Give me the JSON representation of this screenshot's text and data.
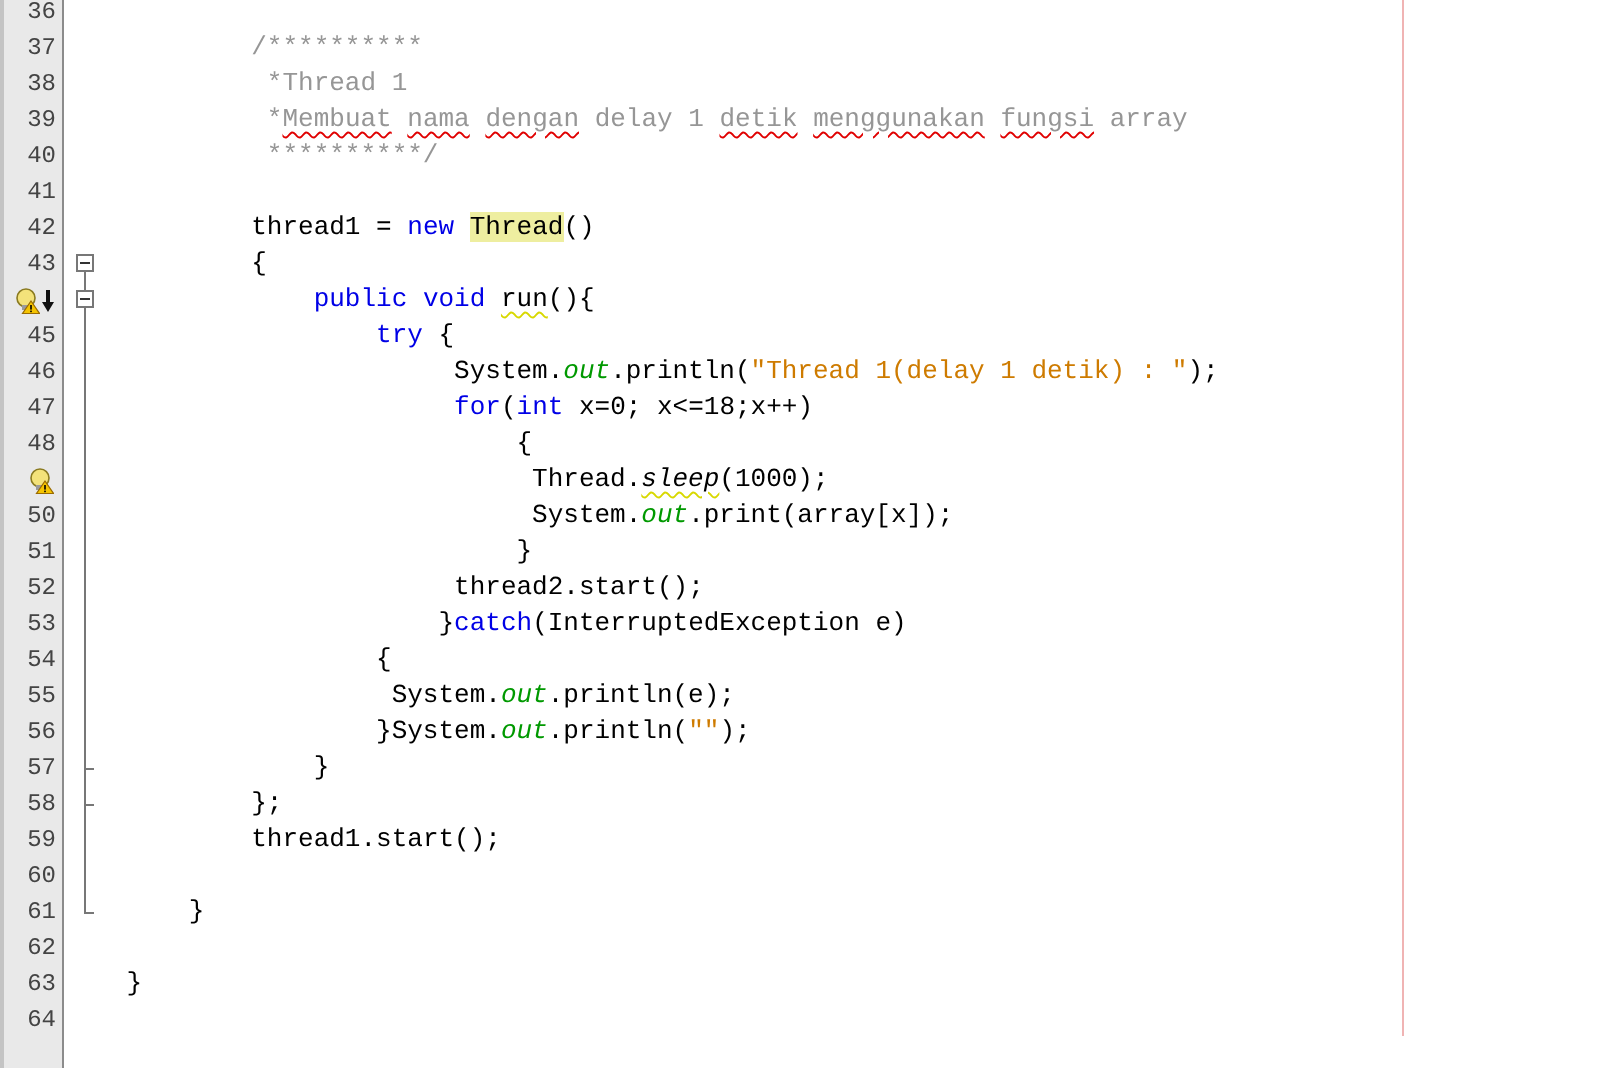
{
  "lines": [
    {
      "number": "36"
    },
    {
      "number": "37",
      "tokens": [
        {
          "kind": "comment",
          "text": "            /**********"
        }
      ]
    },
    {
      "number": "38",
      "tokens": [
        {
          "kind": "comment",
          "text": "             *Thread 1"
        }
      ]
    },
    {
      "number": "39",
      "tokens": [
        {
          "kind": "comment",
          "text": "             *"
        },
        {
          "kind": "misspelled",
          "text": "Membuat"
        },
        {
          "kind": "misspelled",
          "text": " nama"
        },
        {
          "kind": "misspelled",
          "text": " dengan"
        },
        {
          "kind": "comment",
          "text": " delay 1"
        },
        {
          "kind": "misspelled",
          "text": " detik"
        },
        {
          "kind": "misspelled",
          "text": " menggunakan"
        },
        {
          "kind": "misspelled",
          "text": " fungsi"
        },
        {
          "kind": "comment",
          "text": " array"
        }
      ]
    },
    {
      "number": "40",
      "tokens": [
        {
          "kind": "comment",
          "text": "             **********/"
        }
      ]
    },
    {
      "number": "41"
    },
    {
      "number": "42",
      "tokens": [
        {
          "kind": "plain",
          "text": "            thread1 ="
        },
        {
          "kind": "keyword",
          "text": " new"
        },
        {
          "kind": "occurrence",
          "text": " Thread"
        },
        {
          "kind": "plain",
          "text": "()"
        }
      ]
    },
    {
      "number": "43",
      "fold": {
        "kind": "start",
        "expanded": true
      },
      "tokens": [
        {
          "kind": "plain",
          "text": "            {"
        }
      ]
    },
    {
      "markers": [
        {
          "kind": "hint"
        },
        {
          "kind": "implements"
        }
      ],
      "fold": {
        "kind": "start",
        "expanded": true
      },
      "tokens": [
        {
          "kind": "keyword",
          "text": "                public"
        },
        {
          "kind": "keyword",
          "text": " void"
        },
        {
          "kind": "hinted",
          "text": " run"
        },
        {
          "kind": "plain",
          "text": "(){"
        }
      ]
    },
    {
      "number": "45",
      "tokens": [
        {
          "kind": "keyword",
          "text": "                    try"
        },
        {
          "kind": "plain",
          "text": " {"
        }
      ]
    },
    {
      "number": "46",
      "tokens": [
        {
          "kind": "plain",
          "text": "                         System."
        },
        {
          "kind": "field",
          "text": "out"
        },
        {
          "kind": "plain",
          "text": ".println("
        },
        {
          "kind": "string",
          "text": "\"Thread 1(delay 1 detik) : \""
        },
        {
          "kind": "plain",
          "text": ");"
        }
      ]
    },
    {
      "number": "47",
      "tokens": [
        {
          "kind": "keyword",
          "text": "                         for"
        },
        {
          "kind": "plain",
          "text": "("
        },
        {
          "kind": "keyword",
          "text": "int"
        },
        {
          "kind": "plain",
          "text": " x=0; x<=18;x++)"
        }
      ]
    },
    {
      "number": "48",
      "tokens": [
        {
          "kind": "plain",
          "text": "                             {"
        }
      ]
    },
    {
      "markers": [
        {
          "kind": "hint"
        }
      ],
      "tokens": [
        {
          "kind": "plain",
          "text": "                              Thread."
        },
        {
          "kind": "static-hinted",
          "text": "sleep"
        },
        {
          "kind": "plain",
          "text": "(1000);"
        }
      ]
    },
    {
      "number": "50",
      "tokens": [
        {
          "kind": "plain",
          "text": "                              System."
        },
        {
          "kind": "field",
          "text": "out"
        },
        {
          "kind": "plain",
          "text": ".print(array[x]);"
        }
      ]
    },
    {
      "number": "51",
      "tokens": [
        {
          "kind": "plain",
          "text": "                             }"
        }
      ]
    },
    {
      "number": "52",
      "tokens": [
        {
          "kind": "plain",
          "text": "                         thread2.start();"
        }
      ]
    },
    {
      "number": "53",
      "tokens": [
        {
          "kind": "plain",
          "text": "                        }"
        },
        {
          "kind": "keyword",
          "text": "catch"
        },
        {
          "kind": "plain",
          "text": "(InterruptedException e)"
        }
      ]
    },
    {
      "number": "54",
      "tokens": [
        {
          "kind": "plain",
          "text": "                    {"
        }
      ]
    },
    {
      "number": "55",
      "tokens": [
        {
          "kind": "plain",
          "text": "                     System."
        },
        {
          "kind": "field",
          "text": "out"
        },
        {
          "kind": "plain",
          "text": ".println(e);"
        }
      ]
    },
    {
      "number": "56",
      "tokens": [
        {
          "kind": "plain",
          "text": "                    }System."
        },
        {
          "kind": "field",
          "text": "out"
        },
        {
          "kind": "plain",
          "text": ".println("
        },
        {
          "kind": "string",
          "text": "\"\""
        },
        {
          "kind": "plain",
          "text": ");"
        }
      ]
    },
    {
      "number": "57",
      "fold": {
        "kind": "end"
      },
      "tokens": [
        {
          "kind": "plain",
          "text": "                }"
        }
      ]
    },
    {
      "number": "58",
      "fold": {
        "kind": "end"
      },
      "tokens": [
        {
          "kind": "plain",
          "text": "            };"
        }
      ]
    },
    {
      "number": "59",
      "tokens": [
        {
          "kind": "plain",
          "text": "            thread1.start();"
        }
      ]
    },
    {
      "number": "60"
    },
    {
      "number": "61",
      "fold": {
        "kind": "end"
      },
      "tokens": [
        {
          "kind": "plain",
          "text": "        }"
        }
      ]
    },
    {
      "number": "62"
    },
    {
      "number": "63",
      "tokens": [
        {
          "kind": "plain",
          "text": "    }"
        }
      ]
    },
    {
      "number": "64"
    }
  ]
}
